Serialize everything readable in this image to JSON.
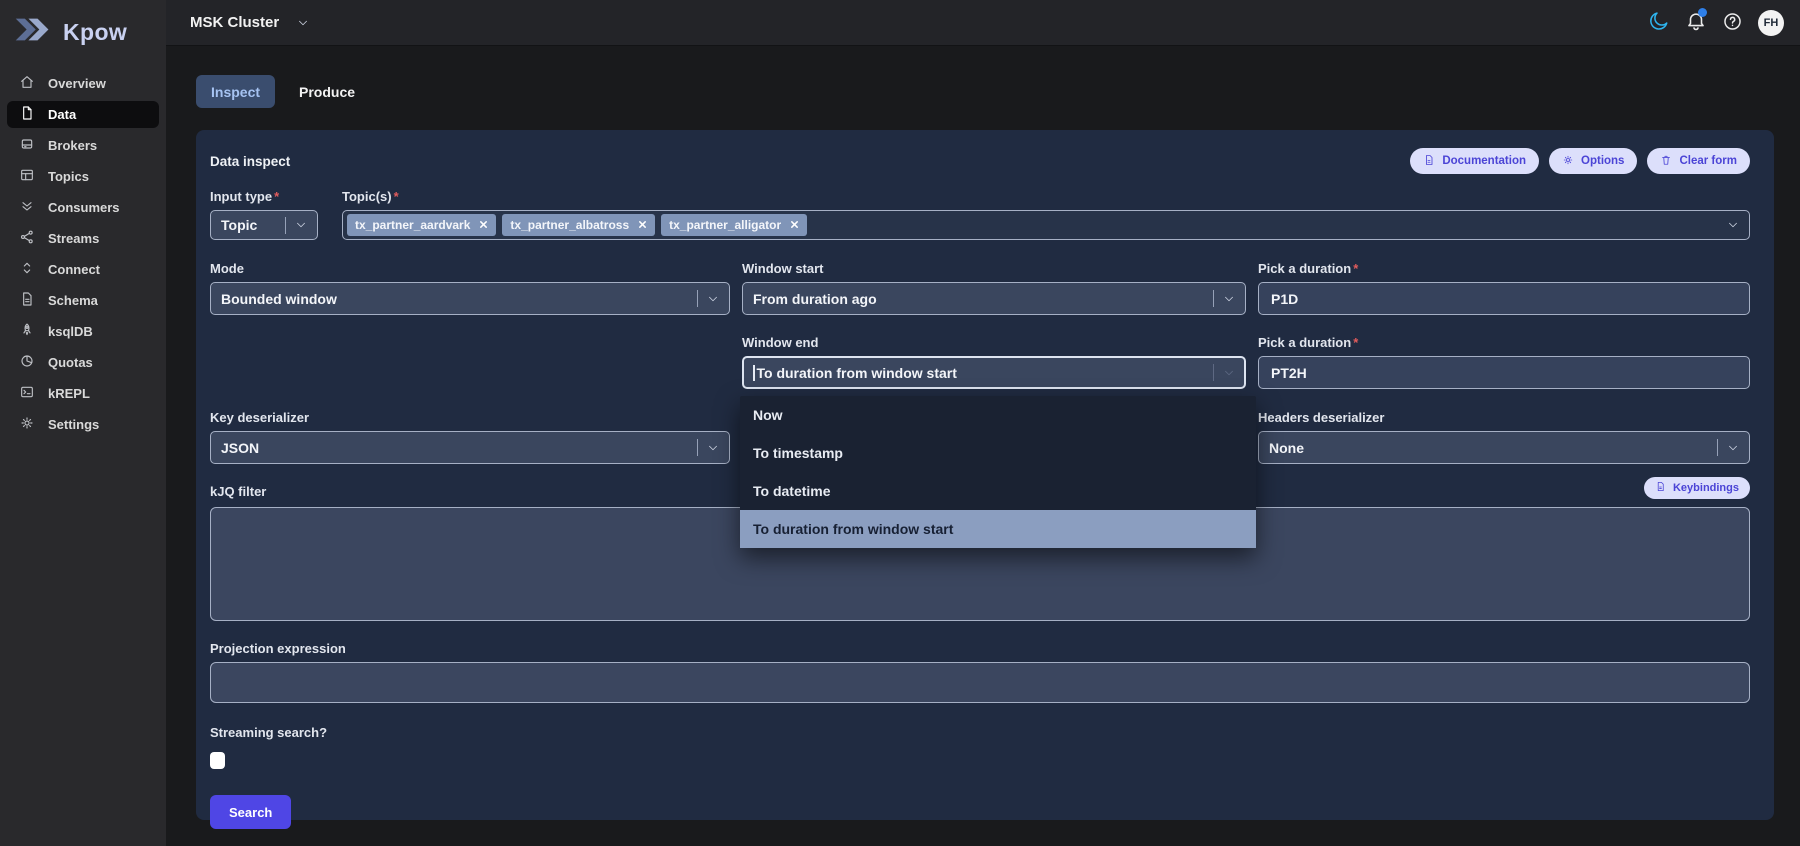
{
  "brand": {
    "name": "Kpow"
  },
  "topbar": {
    "cluster_label": "MSK Cluster",
    "avatar_initials": "FH"
  },
  "sidebar": {
    "items": [
      {
        "label": "Overview",
        "icon": "home",
        "active": false
      },
      {
        "label": "Data",
        "icon": "file",
        "active": true
      },
      {
        "label": "Brokers",
        "icon": "drive",
        "active": false
      },
      {
        "label": "Topics",
        "icon": "table",
        "active": false
      },
      {
        "label": "Consumers",
        "icon": "double-chevron-down",
        "active": false
      },
      {
        "label": "Streams",
        "icon": "share",
        "active": false
      },
      {
        "label": "Connect",
        "icon": "chevrons-up-down",
        "active": false
      },
      {
        "label": "Schema",
        "icon": "document",
        "active": false
      },
      {
        "label": "ksqlDB",
        "icon": "rocket",
        "active": false
      },
      {
        "label": "Quotas",
        "icon": "pie-chart",
        "active": false
      },
      {
        "label": "kREPL",
        "icon": "terminal",
        "active": false
      },
      {
        "label": "Settings",
        "icon": "gear",
        "active": false
      }
    ]
  },
  "tabs": [
    {
      "label": "Inspect",
      "active": true
    },
    {
      "label": "Produce",
      "active": false
    }
  ],
  "form": {
    "title": "Data inspect",
    "required_marker": "*",
    "actions": [
      {
        "label": "Documentation",
        "icon": "document"
      },
      {
        "label": "Options",
        "icon": "gear"
      },
      {
        "label": "Clear form",
        "icon": "trash"
      }
    ],
    "input_type": {
      "label": "Input type",
      "required": true,
      "value": "Topic"
    },
    "topics": {
      "label": "Topic(s)",
      "required": true,
      "tags": [
        "tx_partner_aardvark",
        "tx_partner_albatross",
        "tx_partner_alligator"
      ]
    },
    "mode": {
      "label": "Mode",
      "value": "Bounded window"
    },
    "window_start": {
      "label": "Window start",
      "value": "From duration ago"
    },
    "duration_start": {
      "label": "Pick a duration",
      "required": true,
      "value": "P1D"
    },
    "window_end": {
      "label": "Window end",
      "value": "To duration from window start",
      "options": [
        "Now",
        "To timestamp",
        "To datetime",
        "To duration from window start"
      ],
      "highlighted_option": "To duration from window start"
    },
    "duration_end": {
      "label": "Pick a duration",
      "required": true,
      "value": "PT2H"
    },
    "key_deserializer": {
      "label": "Key deserializer",
      "value": "JSON"
    },
    "headers_deserializer": {
      "label": "Headers deserializer",
      "value": "None"
    },
    "kjq_filter": {
      "label": "kJQ filter",
      "value": "",
      "keybindings_label": "Keybindings"
    },
    "projection": {
      "label": "Projection expression",
      "value": ""
    },
    "streaming": {
      "label": "Streaming search?",
      "checked": false
    },
    "submit_label": "Search"
  },
  "colors": {
    "accent_indigo": "#4f46e5",
    "action_button_bg": "#dcdffb",
    "action_button_text": "#4b44d6",
    "menu_highlight": "#8b9ec0",
    "tab_active_bg": "#3a4d6e",
    "tab_active_text": "#a6c3f2",
    "tag_bg": "#8095b8",
    "moon_icon": "#2eb4ee",
    "notification_dot": "#2e7fe8",
    "required_red": "#e25c5c",
    "card_bg": "#202b41"
  }
}
